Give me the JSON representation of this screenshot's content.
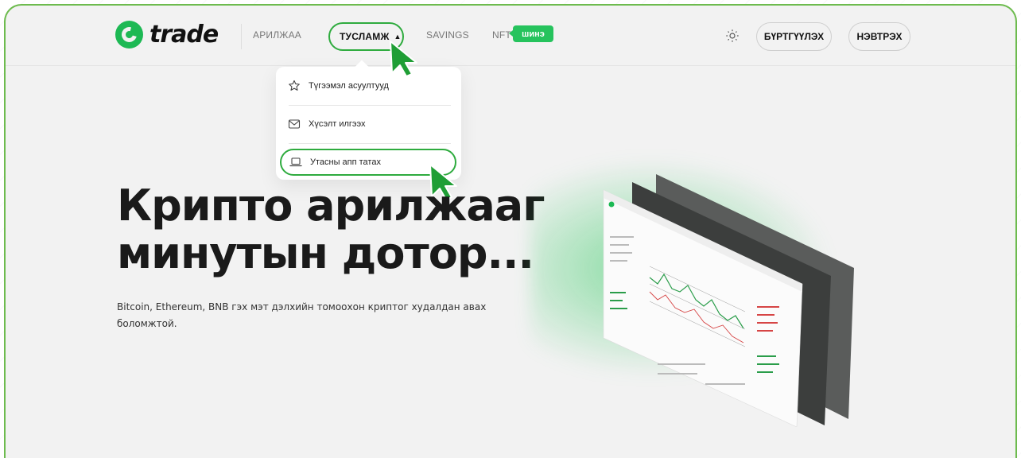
{
  "header": {
    "logo_text": "trade",
    "nav": {
      "arilzhaa": "АРИЛЖАА",
      "tuslamzh": "ТУСЛАМЖ",
      "savings": "SAVINGS",
      "nft": "NFT",
      "new_badge": "шинэ"
    },
    "register_label": "БҮРТГҮҮЛЭХ",
    "login_label": "НЭВТРЭХ"
  },
  "dropdown": {
    "items": [
      {
        "label": "Түгээмэл асуултууд",
        "icon": "star-icon"
      },
      {
        "label": "Хүсэлт илгээх",
        "icon": "mail-icon"
      },
      {
        "label": "Утасны апп татах",
        "icon": "laptop-icon"
      }
    ]
  },
  "hero": {
    "title_line1": "Крипто арилжааг",
    "title_line2": "минутын дотор...",
    "subtitle": "Bitcoin, Ethereum, BNB гэх мэт дэлхийн томоохон криптог худалдан авах боломжтой."
  },
  "colors": {
    "accent": "#26c35d",
    "highlight_border": "#2eab3e",
    "frame_border": "#6dbb4e",
    "background": "#f2f2f2"
  }
}
